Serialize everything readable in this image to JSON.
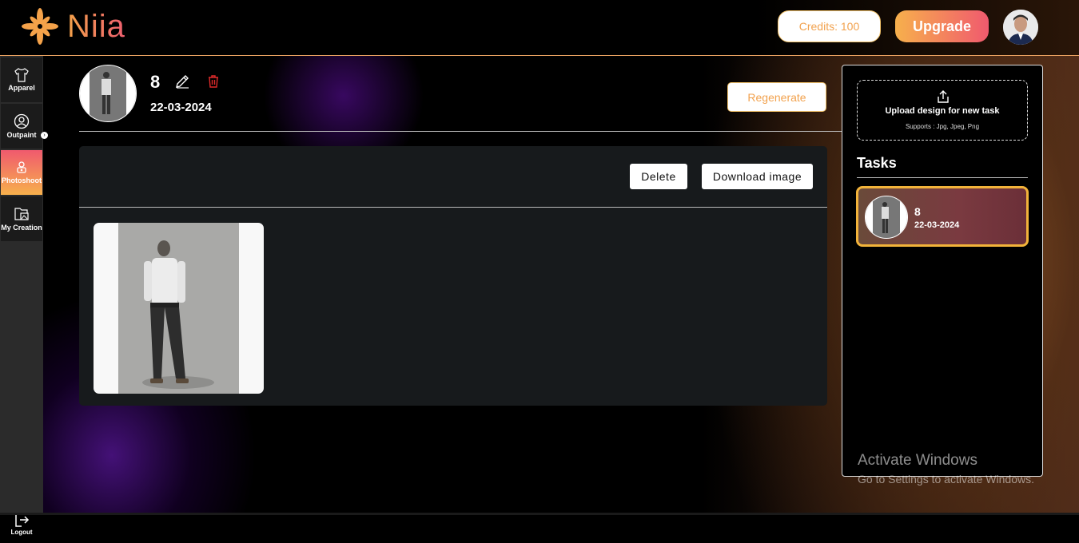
{
  "app": {
    "name": "Niia"
  },
  "header": {
    "logo_text": "Niia",
    "credits_label": "Credits: 100",
    "upgrade_label": "Upgrade"
  },
  "sidebar": {
    "items": [
      {
        "label": "Apparel",
        "icon": "shirt-icon"
      },
      {
        "label": "Outpaint",
        "icon": "user-circle-icon"
      },
      {
        "label": "Photoshoot",
        "icon": "camera-person-icon",
        "active": true
      },
      {
        "label": "My Creation",
        "icon": "folder-image-icon"
      }
    ],
    "logout_label": "Logout"
  },
  "task": {
    "name": "8",
    "date": "22-03-2024",
    "regenerate_label": "Regenerate"
  },
  "panel": {
    "delete_label": "Delete",
    "download_label": "Download image"
  },
  "right_panel": {
    "upload_title": "Upload design for new task",
    "upload_supports": "Supports : Jpg, Jpeg, Png",
    "tasks_title": "Tasks",
    "tasks": [
      {
        "name": "8",
        "date": "22-03-2024",
        "selected": true
      }
    ]
  },
  "watermark": {
    "line1": "Activate Windows",
    "line2": "Go to Settings to activate Windows."
  },
  "colors": {
    "accent_orange": "#f7b04c",
    "accent_pink": "#f05a6e",
    "panel_bg": "#171a1c"
  }
}
